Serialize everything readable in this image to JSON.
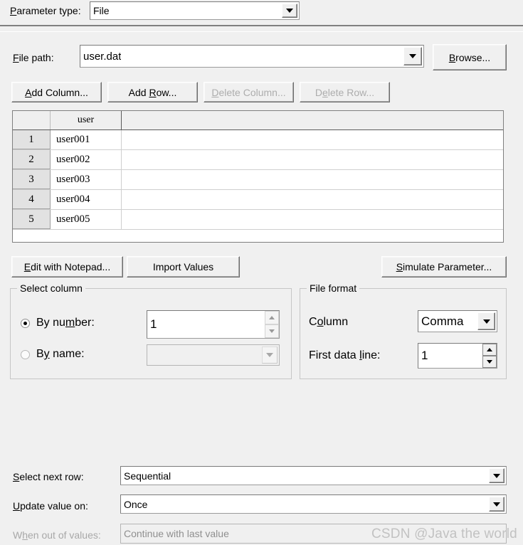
{
  "parameter_type": {
    "label": "Parameter type:",
    "mnemonic": "P",
    "value": "File"
  },
  "file_path": {
    "label": "File path:",
    "mnemonic": "F",
    "value": "user.dat",
    "browse_label": "Browse...",
    "browse_mnemonic": "B"
  },
  "table_buttons": [
    {
      "label": "Add Column...",
      "pre": "",
      "mn": "A",
      "post": "dd Column...",
      "enabled": true
    },
    {
      "label": "Add Row...",
      "pre": "Add ",
      "mn": "R",
      "post": "ow...",
      "enabled": true
    },
    {
      "label": "Delete Column...",
      "pre": "",
      "mn": "D",
      "post": "elete Column...",
      "enabled": false
    },
    {
      "label": "Delete Row...",
      "pre": "D",
      "mn": "e",
      "post": "lete Row...",
      "enabled": false
    }
  ],
  "grid": {
    "columns": [
      "user"
    ],
    "rows": [
      {
        "num": "1",
        "cells": [
          "user001"
        ]
      },
      {
        "num": "2",
        "cells": [
          "user002"
        ]
      },
      {
        "num": "3",
        "cells": [
          "user003"
        ]
      },
      {
        "num": "4",
        "cells": [
          "user004"
        ]
      },
      {
        "num": "5",
        "cells": [
          "user005"
        ]
      }
    ]
  },
  "action_buttons": {
    "edit_notepad": {
      "pre": "",
      "mn": "E",
      "post": "dit with Notepad..."
    },
    "import_values": {
      "pre": "Import Values",
      "mn": "",
      "post": ""
    },
    "simulate": {
      "pre": "",
      "mn": "S",
      "post": "imulate Parameter..."
    }
  },
  "select_column": {
    "title": "Select column",
    "by_number": {
      "pre": "By nu",
      "mn": "m",
      "post": "ber:",
      "selected": true,
      "value": "1"
    },
    "by_name": {
      "pre": "B",
      "mn": "y",
      "post": " name:",
      "selected": false,
      "value": ""
    }
  },
  "file_format": {
    "title": "File format",
    "column": {
      "pre": "C",
      "mn": "o",
      "post": "lumn",
      "value": "Comma"
    },
    "first_data_line": {
      "pre": "First data ",
      "mn": "l",
      "post": "ine:",
      "value": "1"
    }
  },
  "bottom": {
    "select_next_row": {
      "pre": "",
      "mn": "S",
      "post": "elect next row:",
      "value": "Sequential",
      "enabled": true
    },
    "update_value_on": {
      "pre": "",
      "mn": "U",
      "post": "pdate value on:",
      "value": "Once",
      "enabled": true
    },
    "when_out_of_values": {
      "pre": "W",
      "mn": "h",
      "post": "en out of values:",
      "value": "Continue with last value",
      "enabled": false
    }
  },
  "watermark": "CSDN @Java the world"
}
